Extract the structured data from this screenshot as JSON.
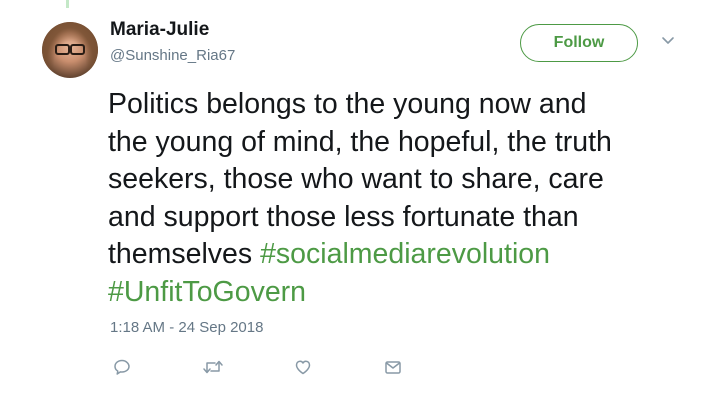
{
  "author": {
    "display_name": "Maria-Julie",
    "handle": "@Sunshine_Ria67",
    "avatar_icon": "user-avatar"
  },
  "follow_button": {
    "label": "Follow"
  },
  "tweet": {
    "text_lines": [
      "Politics belongs to the young now and",
      "the young of mind, the hopeful, the truth",
      "seekers, those who want to share, care",
      "and support those less fortunate than",
      "themselves "
    ],
    "hashtags": [
      "#socialmediarevolution",
      "#UnfitToGovern"
    ],
    "timestamp": "1:18 AM - 24 Sep 2018"
  },
  "actions": [
    {
      "icon": "reply-icon"
    },
    {
      "icon": "retweet-icon"
    },
    {
      "icon": "like-icon"
    },
    {
      "icon": "direct-message-icon"
    }
  ],
  "colors": {
    "accent": "#4d9a45",
    "text": "#14171a",
    "muted": "#657786"
  }
}
